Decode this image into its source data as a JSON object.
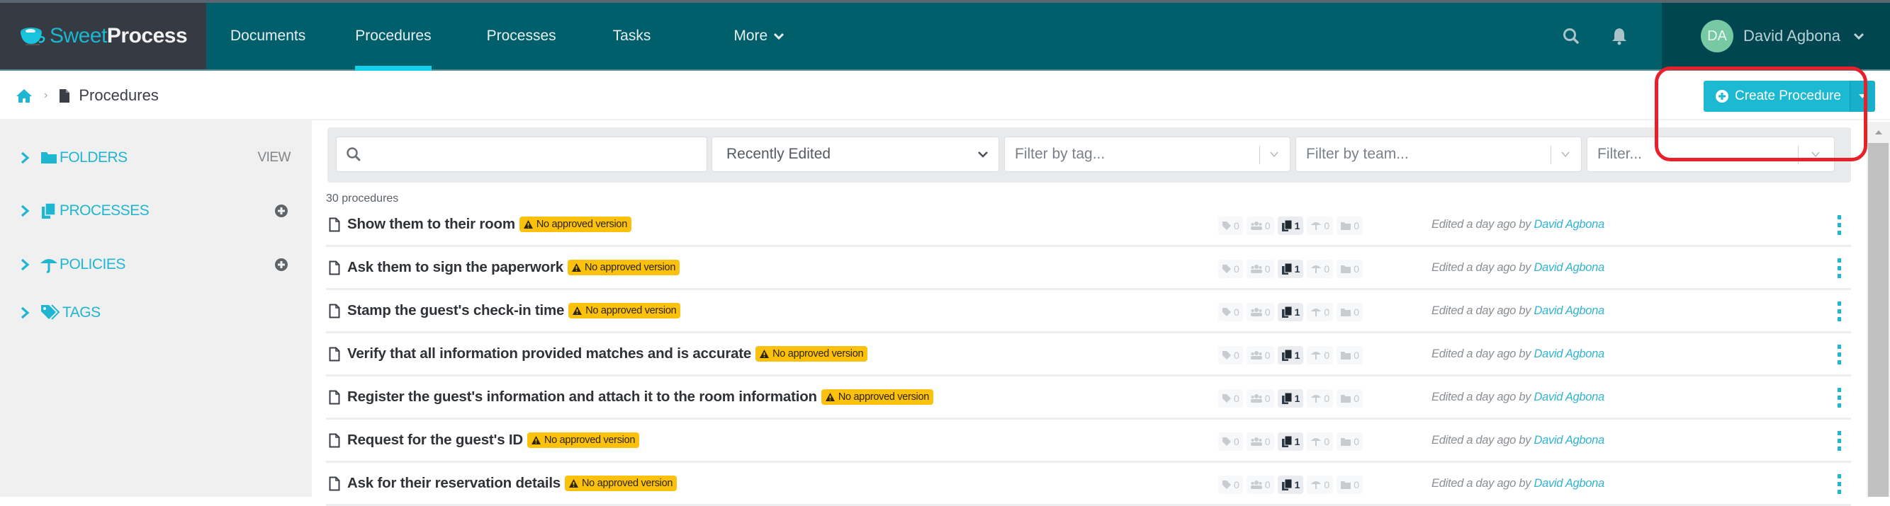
{
  "app": {
    "brand_first": "Sweet",
    "brand_second": "Process"
  },
  "nav": {
    "items": [
      {
        "label": "Documents",
        "active": false
      },
      {
        "label": "Procedures",
        "active": true
      },
      {
        "label": "Processes",
        "active": false
      },
      {
        "label": "Tasks",
        "active": false
      },
      {
        "label": "More",
        "active": false
      }
    ],
    "user": {
      "initials": "DA",
      "name": "David Agbona"
    }
  },
  "breadcrumb": {
    "home_icon": "home-icon",
    "current": "Procedures"
  },
  "actions": {
    "create_label": "Create Procedure"
  },
  "sidebar": {
    "items": [
      {
        "label": "FOLDERS",
        "icon": "folder-icon",
        "action": "VIEW"
      },
      {
        "label": "PROCESSES",
        "icon": "copy-icon",
        "action": "plus-circle-icon"
      },
      {
        "label": "POLICIES",
        "icon": "umbrella-icon",
        "action": "plus-circle-icon"
      },
      {
        "label": "TAGS",
        "icon": "tags-icon",
        "action": ""
      }
    ]
  },
  "filters": {
    "search_placeholder": "",
    "sort_value": "Recently Edited",
    "tag_placeholder": "Filter by tag...",
    "team_placeholder": "Filter by team...",
    "other_placeholder": "Filter..."
  },
  "list": {
    "count_label": "30 procedures",
    "badge_label": "No approved version",
    "edited_prefix": "Edited a day ago by",
    "rows": [
      {
        "title": "Show them to their room",
        "tags": "0",
        "members": "0",
        "processes": "1",
        "policies": "0",
        "folders": "0",
        "editor": "David Agbona"
      },
      {
        "title": "Ask them to sign the paperwork",
        "tags": "0",
        "members": "0",
        "processes": "1",
        "policies": "0",
        "folders": "0",
        "editor": "David Agbona"
      },
      {
        "title": "Stamp the guest's check-in time",
        "tags": "0",
        "members": "0",
        "processes": "1",
        "policies": "0",
        "folders": "0",
        "editor": "David Agbona"
      },
      {
        "title": "Verify that all information provided matches and is accurate",
        "tags": "0",
        "members": "0",
        "processes": "1",
        "policies": "0",
        "folders": "0",
        "editor": "David Agbona"
      },
      {
        "title": "Register the guest's information and attach it to the room information",
        "tags": "0",
        "members": "0",
        "processes": "1",
        "policies": "0",
        "folders": "0",
        "editor": "David Agbona"
      },
      {
        "title": "Request for the guest's ID",
        "tags": "0",
        "members": "0",
        "processes": "1",
        "policies": "0",
        "folders": "0",
        "editor": "David Agbona"
      },
      {
        "title": "Ask for their reservation details",
        "tags": "0",
        "members": "0",
        "processes": "1",
        "policies": "0",
        "folders": "0",
        "editor": "David Agbona"
      }
    ]
  },
  "colors": {
    "nav_bg": "#005f6b",
    "logo_bg": "#363a42",
    "accent": "#1fb6d2",
    "badge": "#fcc10c",
    "highlight": "#e8202a"
  }
}
